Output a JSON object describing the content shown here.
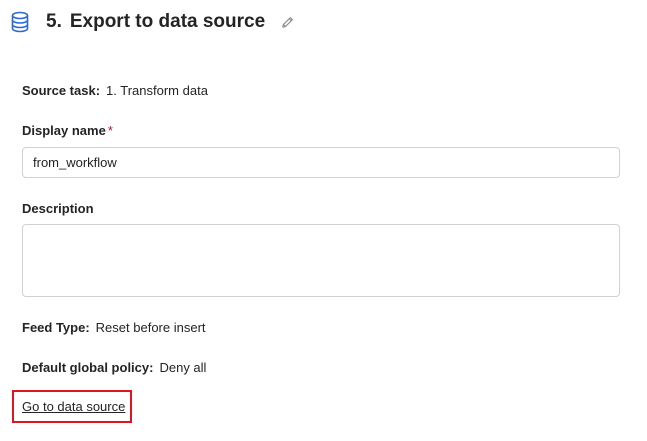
{
  "header": {
    "icon": "database-icon",
    "task_number": "5.",
    "title": "Export to data source",
    "edit_icon": "pencil-icon"
  },
  "source_task": {
    "label": "Source task:",
    "value": "1. Transform data"
  },
  "display_name": {
    "label": "Display name",
    "required_mark": "*",
    "value": "from_workflow"
  },
  "description": {
    "label": "Description",
    "value": ""
  },
  "feed_type": {
    "label": "Feed Type:",
    "value": "Reset before insert"
  },
  "default_global_policy": {
    "label": "Default global policy:",
    "value": "Deny all"
  },
  "go_to_data_source": {
    "label": "Go to data source"
  },
  "colors": {
    "icon_blue": "#2e6ad1",
    "highlight_red": "#e0141e",
    "required_red": "#c50f1f"
  }
}
